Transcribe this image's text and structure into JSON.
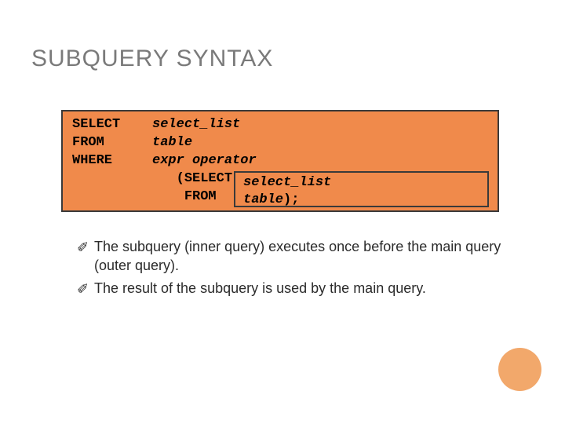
{
  "title": "SUBQUERY SYNTAX",
  "code": {
    "line1_kw": "SELECT",
    "line1_it": "select_list",
    "line2_kw": "FROM",
    "line2_it": "table",
    "line3_kw": "WHERE",
    "line3_it": "expr operator",
    "line4_paren": "(",
    "line4_kw": "SELECT",
    "line5_kw": "FROM"
  },
  "inner": {
    "line1_it": "select_list",
    "line2_it": "table",
    "line2_tail": ");"
  },
  "bullets": [
    "The subquery (inner query) executes once before the main query (outer query).",
    "The result of the subquery is used by the main query."
  ],
  "bullet_glyph": "✐"
}
